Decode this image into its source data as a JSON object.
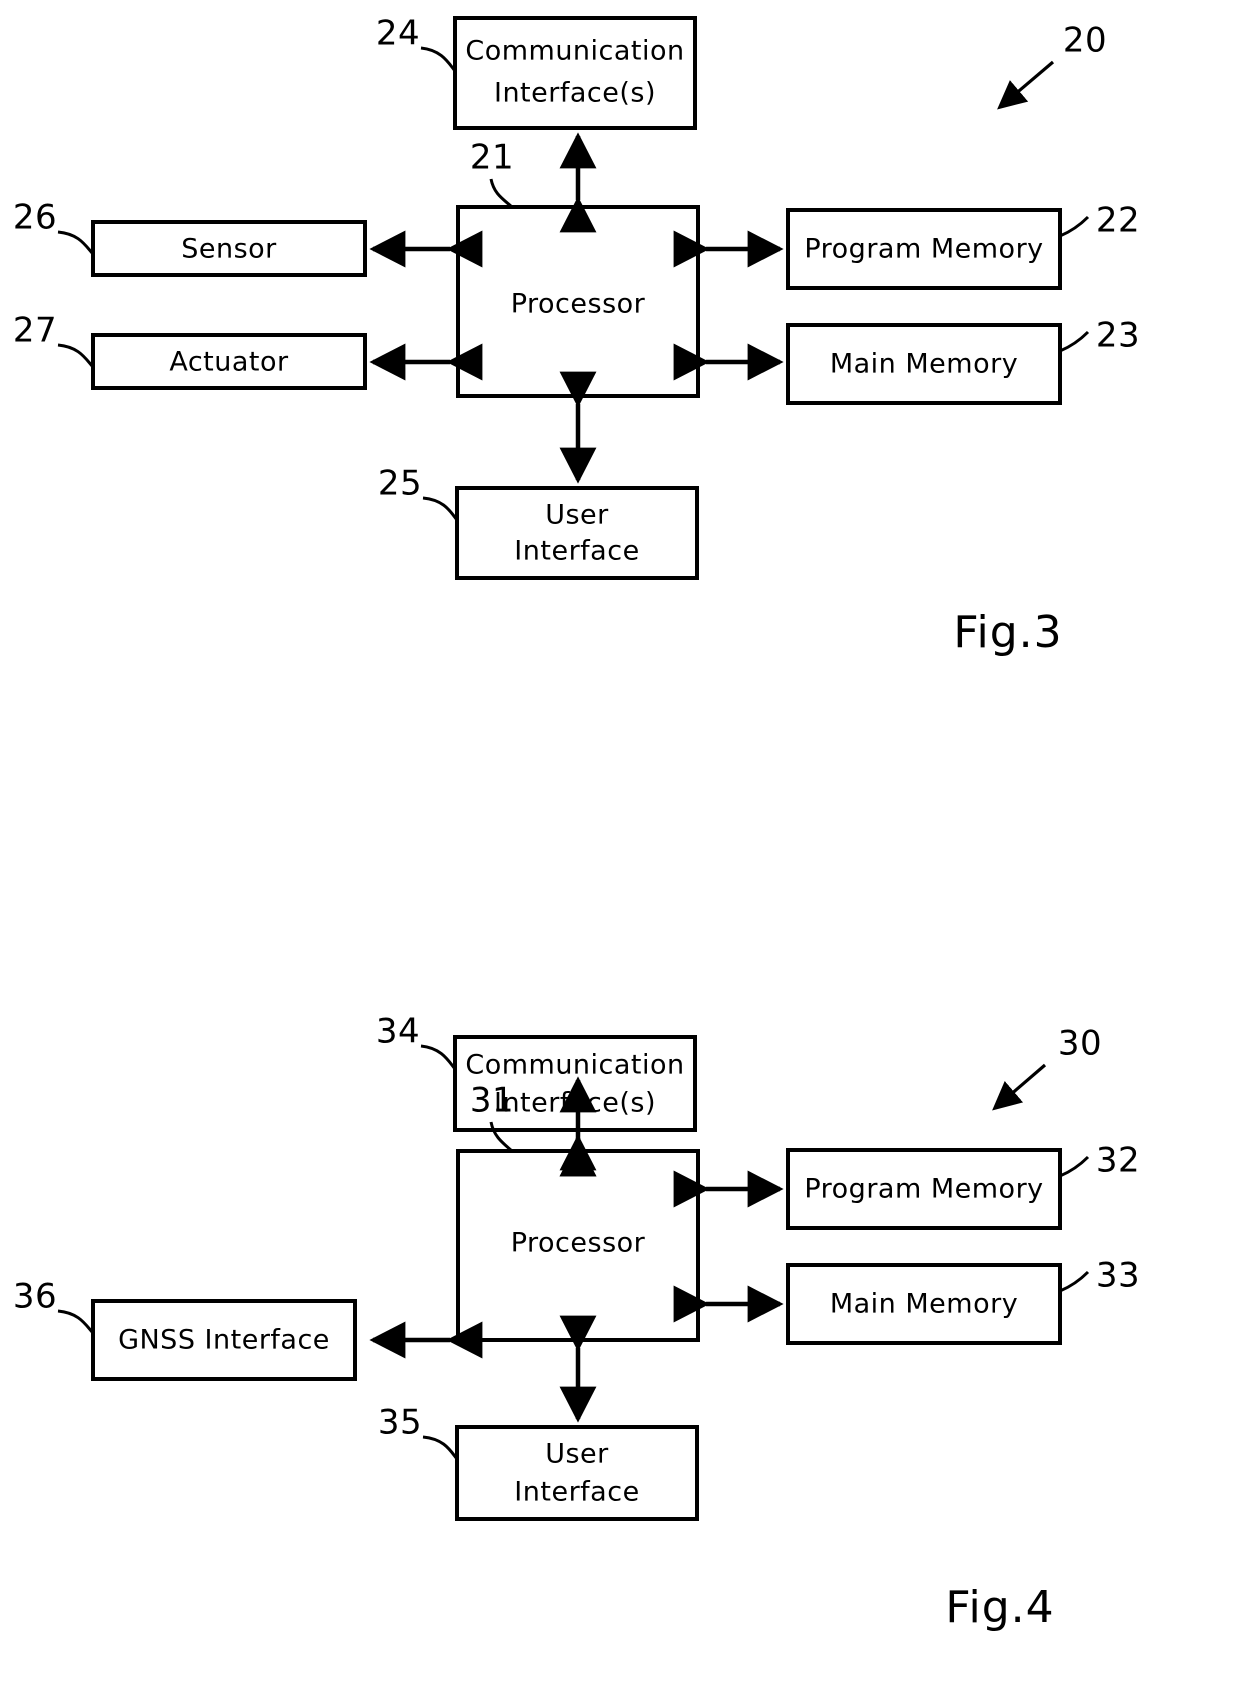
{
  "document": {
    "type": "patent-drawing-sheet",
    "figures": [
      {
        "caption": "Fig.3",
        "system_ref": "20",
        "blocks": [
          {
            "ref": "24",
            "label_line1": "Communication",
            "label_line2": "Interface(s)",
            "position": "top"
          },
          {
            "ref": "21",
            "label_line1": "Processor",
            "label_line2": "",
            "position": "center"
          },
          {
            "ref": "26",
            "label_line1": "Sensor",
            "label_line2": "",
            "position": "left-upper"
          },
          {
            "ref": "27",
            "label_line1": "Actuator",
            "label_line2": "",
            "position": "left-lower"
          },
          {
            "ref": "22",
            "label_line1": "Program Memory",
            "label_line2": "",
            "position": "right-upper"
          },
          {
            "ref": "23",
            "label_line1": "Main Memory",
            "label_line2": "",
            "position": "right-lower"
          },
          {
            "ref": "25",
            "label_line1": "User",
            "label_line2": "Interface",
            "position": "bottom"
          }
        ]
      },
      {
        "caption": "Fig.4",
        "system_ref": "30",
        "blocks": [
          {
            "ref": "34",
            "label_line1": "Communication",
            "label_line2": "Interface(s)",
            "position": "top"
          },
          {
            "ref": "31",
            "label_line1": "Processor",
            "label_line2": "",
            "position": "center"
          },
          {
            "ref": "36",
            "label_line1": "GNSS Interface",
            "label_line2": "",
            "position": "left"
          },
          {
            "ref": "32",
            "label_line1": "Program Memory",
            "label_line2": "",
            "position": "right-upper"
          },
          {
            "ref": "33",
            "label_line1": "Main Memory",
            "label_line2": "",
            "position": "right-lower"
          },
          {
            "ref": "35",
            "label_line1": "User",
            "label_line2": "Interface",
            "position": "bottom"
          }
        ]
      }
    ]
  },
  "fig3": {
    "caption": "Fig.3",
    "system_ref": "20",
    "comm": {
      "ref": "24",
      "line1": "Communication",
      "line2": "Interface(s)"
    },
    "processor": {
      "ref": "21",
      "label": "Processor"
    },
    "sensor": {
      "ref": "26",
      "label": "Sensor"
    },
    "actuator": {
      "ref": "27",
      "label": "Actuator"
    },
    "program_memory": {
      "ref": "22",
      "label": "Program Memory"
    },
    "main_memory": {
      "ref": "23",
      "label": "Main Memory"
    },
    "user_interface": {
      "ref": "25",
      "line1": "User",
      "line2": "Interface"
    }
  },
  "fig4": {
    "caption": "Fig.4",
    "system_ref": "30",
    "comm": {
      "ref": "34",
      "line1": "Communication",
      "line2": "Interface(s)"
    },
    "processor": {
      "ref": "31",
      "label": "Processor"
    },
    "gnss": {
      "ref": "36",
      "label": "GNSS Interface"
    },
    "program_memory": {
      "ref": "32",
      "label": "Program Memory"
    },
    "main_memory": {
      "ref": "33",
      "label": "Main Memory"
    },
    "user_interface": {
      "ref": "35",
      "line1": "User",
      "line2": "Interface"
    }
  },
  "colors": {
    "ink": "#000000",
    "paper": "#ffffff"
  }
}
